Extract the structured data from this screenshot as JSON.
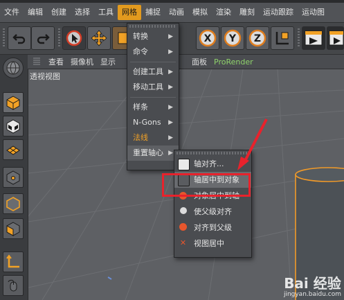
{
  "menubar": {
    "items": [
      "文件",
      "编辑",
      "创建",
      "选择",
      "工具",
      "网格",
      "捕捉",
      "动画",
      "模拟",
      "渲染",
      "雕刻",
      "运动跟踪",
      "运动图"
    ]
  },
  "toolbar": {
    "buttons": [
      "undo-icon",
      "redo-icon",
      "live-selection-icon",
      "move-icon",
      "scale-icon",
      "x-axis-icon",
      "y-axis-icon",
      "z-axis-icon",
      "world-coord-icon",
      "render-view-icon",
      "render-icon"
    ],
    "axis_labels": [
      "X",
      "Y",
      "Z"
    ]
  },
  "viewbar": {
    "items": [
      "查看",
      "摄像机",
      "显示",
      "面板",
      "ProRender"
    ]
  },
  "viewport": {
    "label": "透视视图"
  },
  "mesh_menu": {
    "items": [
      {
        "label": "转换",
        "submenu": true
      },
      {
        "label": "命令",
        "submenu": true
      },
      {
        "label": "创建工具",
        "submenu": true
      },
      {
        "label": "移动工具",
        "submenu": true
      },
      {
        "label": "样条",
        "submenu": true
      },
      {
        "label": "N-Gons",
        "submenu": true
      },
      {
        "label": "法线",
        "submenu": true
      },
      {
        "label": "重置轴心",
        "submenu": true
      }
    ],
    "arrow": "▶"
  },
  "axis_submenu": {
    "items": [
      {
        "label": "轴对齐...",
        "icon": "axis-align-icon"
      },
      {
        "label": "轴居中到对象",
        "icon": "axis-center-object-icon"
      },
      {
        "label": "对象居中到轴",
        "icon": "object-center-axis-icon"
      },
      {
        "label": "使父级对齐",
        "icon": "align-parent-icon"
      },
      {
        "label": "对齐到父级",
        "icon": "align-to-parent-icon"
      },
      {
        "label": "视图居中",
        "icon": "view-center-icon"
      }
    ]
  },
  "watermark": {
    "line1": "Bai 经验",
    "line2": "jingyan.baidu.com"
  },
  "colors": {
    "accent": "#e29a1e",
    "highlight": "#e8222c"
  }
}
